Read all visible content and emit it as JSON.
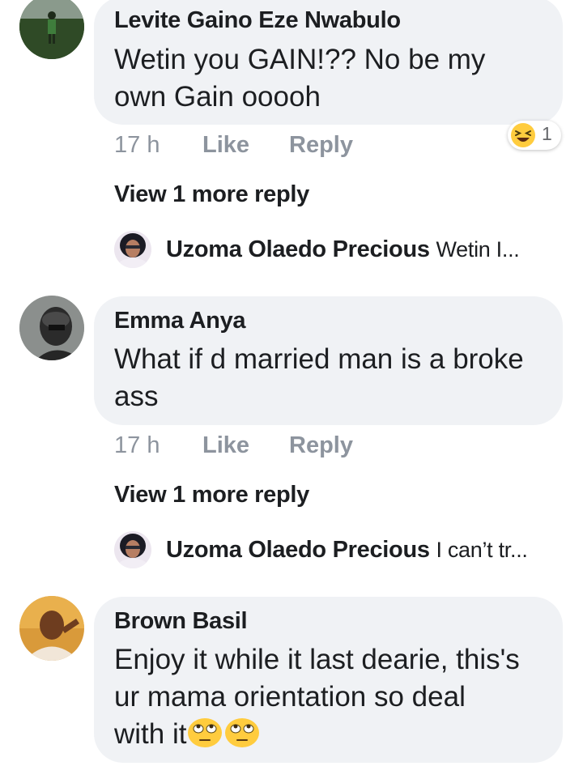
{
  "comments": [
    {
      "author": "Levite Gaino Eze Nwabulo",
      "text_lines": [
        "Wetin you GAIN!?? No be my",
        "own Gain ooooh"
      ],
      "time": "17 h",
      "like": "Like",
      "reply": "Reply",
      "reaction": {
        "icon": "laughing-emoji",
        "count": "1"
      },
      "more_replies": "View 1 more reply",
      "reply_preview": {
        "author": "Uzoma Olaedo Precious",
        "snippet": "Wetin I..."
      }
    },
    {
      "author": "Emma Anya",
      "text_lines": [
        "What if d married man is a broke",
        "ass"
      ],
      "time": "17 h",
      "like": "Like",
      "reply": "Reply",
      "more_replies": "View 1 more reply",
      "reply_preview": {
        "author": "Uzoma Olaedo Precious",
        "snippet": "I can’t tr..."
      }
    },
    {
      "author": "Brown Basil",
      "text_lines": [
        "Enjoy it while it last dearie, this's",
        "ur mama orientation so deal",
        "with it"
      ],
      "emoji": [
        "face-with-rolling-eyes",
        "face-with-rolling-eyes"
      ]
    }
  ],
  "colors": {
    "bubble": "#f0f2f5",
    "meta": "#8d949e",
    "text": "#1c1e21",
    "emoji": "#ffcc3e"
  }
}
